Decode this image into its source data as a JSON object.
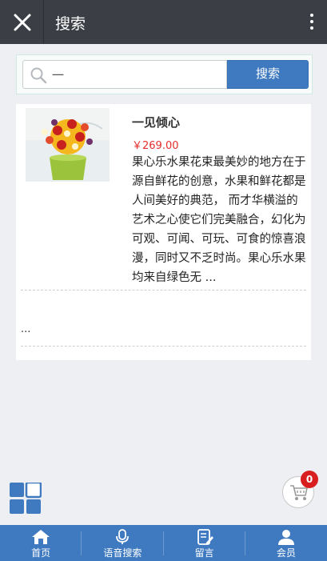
{
  "header": {
    "title": "搜索",
    "close_icon": "close-icon",
    "more_icon": "more-vertical-icon"
  },
  "search": {
    "value": "一",
    "button_label": "搜索",
    "icon": "search-icon"
  },
  "results": [
    {
      "name": "一见倾心",
      "price": "￥269.00",
      "description": "果心乐水果花束最美妙的地方在于源自鲜花的创意，水果和鲜花都是人间美好的典范， 而才华横溢的艺术之心使它们完美融合，幻化为可观、可闻、可玩、可食的惊喜浪漫，同时又不乏时尚。果心乐水果均来自绿色无 ..."
    }
  ],
  "more_text": "...",
  "cart": {
    "count": "0"
  },
  "bottom_nav": [
    {
      "label": "首页",
      "icon": "home-icon"
    },
    {
      "label": "语音搜索",
      "icon": "microphone-icon"
    },
    {
      "label": "留言",
      "icon": "message-edit-icon"
    },
    {
      "label": "会员",
      "icon": "user-icon"
    }
  ],
  "colors": {
    "topbar": "#3b3e45",
    "accent": "#3f7ac0",
    "price": "#e62e2e",
    "badge": "#d81e1e"
  }
}
